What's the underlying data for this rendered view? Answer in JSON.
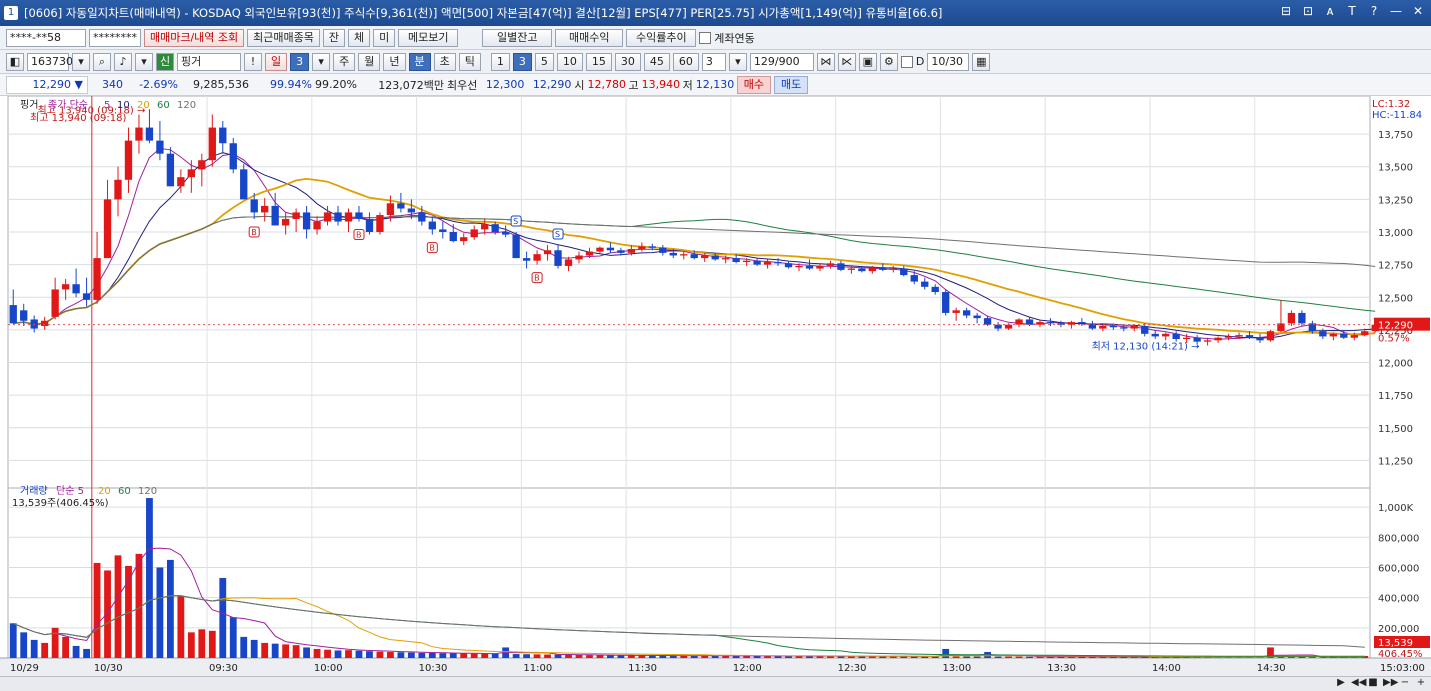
{
  "window": {
    "screen_code": "[0606]",
    "title": "자동일지차트(매매내역) - KOSDAQ 외국인보유[93(천)] 주식수[9,361(천)] 액면[500] 자본금[47(억)] 결산[12월] EPS[477] PER[25.75] 시가총액[1,149(억)] 유통비율[66.6]",
    "controls": [
      "⊟",
      "⊡",
      "ᴀ",
      "T",
      "?",
      "—",
      "✕"
    ]
  },
  "toolbar1": {
    "account": "****-**58",
    "password": "********",
    "btn_mark": "매매마크/내역 조회",
    "btn_recent": "최근매매종목",
    "btn_jan": "잔",
    "btn_che": "체",
    "btn_mi": "미",
    "btn_memo": "메모보기",
    "btn_daily_balance": "일별잔고",
    "btn_profit": "매매수익",
    "btn_return": "수익률추이",
    "chk_link": "계좌연동"
  },
  "toolbar2": {
    "code": "163730",
    "badge": "신",
    "stock_name": "핑거",
    "periods": [
      "일",
      "3",
      "주",
      "월",
      "년",
      "분",
      "초",
      "틱"
    ],
    "minutes": [
      "1",
      "3",
      "5",
      "10",
      "15",
      "30",
      "45",
      "60"
    ],
    "interval": "3",
    "count": "129",
    "count_max": "/900",
    "date_label": "D",
    "date": "10/30"
  },
  "quote": {
    "price": "12,290",
    "arrow": "▼",
    "change": "340",
    "change_pct": "-2.69%",
    "volume": "9,285,536",
    "vol_ratio": "99.94%",
    "vol_ratio2": "99.20%",
    "amount": "123,072백만",
    "best_label": "최우선",
    "best_ask": "12,300",
    "best_bid": "12,290",
    "open_label": "시",
    "open": "12,780",
    "high_label": "고",
    "high": "13,940",
    "low_label": "저",
    "low": "12,130",
    "buy": "매수",
    "sell": "매도"
  },
  "chart_data": [
    {
      "type": "candlestick",
      "panel": "price",
      "title": "핑거",
      "legend": [
        {
          "name": "종가 단순",
          "color": "#000000"
        },
        {
          "name": "5",
          "color": "#a020a0"
        },
        {
          "name": "10",
          "color": "#202080"
        },
        {
          "name": "20",
          "color": "#e0a000"
        },
        {
          "name": "60",
          "color": "#208040"
        },
        {
          "name": "120",
          "color": "#707070"
        }
      ],
      "ylim": [
        11100,
        13950
      ],
      "yticks": [
        13750,
        13500,
        13250,
        13000,
        12750,
        12500,
        12250,
        12000,
        11750,
        11500,
        11250
      ],
      "ytick_labels": [
        "13,750",
        "13,500",
        "13,250",
        "13,000",
        "12,750",
        "12,500",
        "12,250",
        "12,000",
        "11,750",
        "11,500",
        "11,250"
      ],
      "x_labels": [
        "10/29",
        "10/30",
        "09:30",
        "10:00",
        "10:30",
        "11:00",
        "11:30",
        "12:00",
        "12:30",
        "13:00",
        "13:30",
        "14:00",
        "14:30",
        "15:03:00"
      ],
      "x_label_bars": [
        0,
        8,
        19,
        29,
        39,
        49,
        59,
        69,
        79,
        89,
        99,
        109,
        119,
        129
      ],
      "bar_count": 130,
      "current_price": "12,290",
      "current_value": 12290,
      "current_pct": "0.57%",
      "lc": "LC:1.32",
      "hc": "HC:-11.84",
      "high_note": "최고 13,940 (09:18)",
      "low_note": "최저 12,130 (14:21)",
      "bars": [
        [
          12440,
          12560,
          12350,
          12300
        ],
        [
          12400,
          12450,
          12280,
          12320
        ],
        [
          12330,
          12360,
          12230,
          12260
        ],
        [
          12280,
          12350,
          12250,
          12320
        ],
        [
          12350,
          12650,
          12330,
          12560
        ],
        [
          12560,
          12640,
          12480,
          12600
        ],
        [
          12600,
          12720,
          12500,
          12530
        ],
        [
          12530,
          12650,
          12430,
          12480
        ],
        [
          12480,
          13000,
          12450,
          12800
        ],
        [
          12800,
          13400,
          12800,
          13250
        ],
        [
          13250,
          13500,
          13120,
          13400
        ],
        [
          13400,
          13800,
          13300,
          13700
        ],
        [
          13700,
          13900,
          13600,
          13800
        ],
        [
          13800,
          13940,
          13680,
          13700
        ],
        [
          13700,
          13850,
          13550,
          13600
        ],
        [
          13600,
          13650,
          13350,
          13350
        ],
        [
          13350,
          13480,
          13300,
          13420
        ],
        [
          13420,
          13550,
          13300,
          13480
        ],
        [
          13480,
          13600,
          13350,
          13550
        ],
        [
          13550,
          13900,
          13500,
          13800
        ],
        [
          13800,
          13850,
          13600,
          13680
        ],
        [
          13680,
          13720,
          13450,
          13480
        ],
        [
          13480,
          13520,
          13250,
          13250
        ],
        [
          13250,
          13300,
          13100,
          13150
        ],
        [
          13150,
          13260,
          13080,
          13200
        ],
        [
          13200,
          13300,
          13050,
          13050
        ],
        [
          13050,
          13150,
          12980,
          13100
        ],
        [
          13100,
          13180,
          13000,
          13150
        ],
        [
          13150,
          13200,
          12950,
          13020
        ],
        [
          13020,
          13120,
          12980,
          13080
        ],
        [
          13080,
          13200,
          13050,
          13150
        ],
        [
          13150,
          13200,
          13050,
          13080
        ],
        [
          13080,
          13180,
          13000,
          13150
        ],
        [
          13150,
          13200,
          13080,
          13100
        ],
        [
          13100,
          13150,
          12980,
          13000
        ],
        [
          13000,
          13150,
          12980,
          13130
        ],
        [
          13130,
          13280,
          13080,
          13220
        ],
        [
          13220,
          13300,
          13150,
          13180
        ],
        [
          13180,
          13250,
          13100,
          13150
        ],
        [
          13150,
          13200,
          13050,
          13080
        ],
        [
          13080,
          13120,
          12980,
          13020
        ],
        [
          13020,
          13080,
          12950,
          13000
        ],
        [
          13000,
          13060,
          12920,
          12930
        ],
        [
          12930,
          12990,
          12900,
          12960
        ],
        [
          12960,
          13050,
          12940,
          13020
        ],
        [
          13020,
          13100,
          12980,
          13060
        ],
        [
          13060,
          13080,
          12980,
          13000
        ],
        [
          13000,
          13050,
          12960,
          12980
        ],
        [
          12980,
          13000,
          12800,
          12800
        ],
        [
          12800,
          12850,
          12720,
          12780
        ],
        [
          12780,
          12860,
          12750,
          12830
        ],
        [
          12830,
          12900,
          12780,
          12860
        ],
        [
          12860,
          12900,
          12720,
          12740
        ],
        [
          12740,
          12810,
          12700,
          12790
        ],
        [
          12790,
          12850,
          12760,
          12820
        ],
        [
          12820,
          12880,
          12800,
          12850
        ],
        [
          12850,
          12890,
          12830,
          12880
        ],
        [
          12880,
          12920,
          12840,
          12860
        ],
        [
          12860,
          12880,
          12820,
          12840
        ],
        [
          12840,
          12900,
          12820,
          12870
        ],
        [
          12870,
          12920,
          12850,
          12890
        ],
        [
          12890,
          12910,
          12860,
          12880
        ],
        [
          12880,
          12900,
          12820,
          12840
        ],
        [
          12840,
          12870,
          12800,
          12820
        ],
        [
          12820,
          12850,
          12790,
          12830
        ],
        [
          12830,
          12860,
          12790,
          12800
        ],
        [
          12800,
          12840,
          12770,
          12820
        ],
        [
          12820,
          12840,
          12780,
          12790
        ],
        [
          12790,
          12820,
          12760,
          12800
        ],
        [
          12800,
          12830,
          12760,
          12770
        ],
        [
          12770,
          12800,
          12740,
          12780
        ],
        [
          12780,
          12800,
          12740,
          12750
        ],
        [
          12750,
          12790,
          12720,
          12770
        ],
        [
          12770,
          12800,
          12740,
          12760
        ],
        [
          12760,
          12780,
          12720,
          12730
        ],
        [
          12730,
          12760,
          12700,
          12740
        ],
        [
          12740,
          12790,
          12710,
          12720
        ],
        [
          12720,
          12760,
          12700,
          12740
        ],
        [
          12740,
          12780,
          12720,
          12760
        ],
        [
          12760,
          12780,
          12700,
          12710
        ],
        [
          12710,
          12740,
          12680,
          12720
        ],
        [
          12720,
          12740,
          12690,
          12700
        ],
        [
          12700,
          12740,
          12680,
          12730
        ],
        [
          12730,
          12760,
          12700,
          12710
        ],
        [
          12710,
          12740,
          12690,
          12720
        ],
        [
          12720,
          12740,
          12660,
          12670
        ],
        [
          12670,
          12700,
          12600,
          12620
        ],
        [
          12620,
          12650,
          12560,
          12580
        ],
        [
          12580,
          12600,
          12520,
          12540
        ],
        [
          12540,
          12560,
          12360,
          12380
        ],
        [
          12380,
          12420,
          12320,
          12400
        ],
        [
          12400,
          12420,
          12340,
          12360
        ],
        [
          12360,
          12380,
          12300,
          12340
        ],
        [
          12340,
          12360,
          12280,
          12290
        ],
        [
          12290,
          12310,
          12240,
          12260
        ],
        [
          12260,
          12300,
          12250,
          12290
        ],
        [
          12290,
          12340,
          12270,
          12330
        ],
        [
          12330,
          12350,
          12280,
          12290
        ],
        [
          12290,
          12330,
          12270,
          12310
        ],
        [
          12310,
          12340,
          12280,
          12300
        ],
        [
          12300,
          12320,
          12270,
          12290
        ],
        [
          12290,
          12320,
          12260,
          12310
        ],
        [
          12310,
          12340,
          12280,
          12300
        ],
        [
          12300,
          12320,
          12250,
          12260
        ],
        [
          12260,
          12290,
          12240,
          12280
        ],
        [
          12280,
          12300,
          12250,
          12270
        ],
        [
          12270,
          12290,
          12240,
          12260
        ],
        [
          12260,
          12290,
          12240,
          12280
        ],
        [
          12280,
          12300,
          12200,
          12220
        ],
        [
          12220,
          12250,
          12180,
          12200
        ],
        [
          12200,
          12230,
          12170,
          12220
        ],
        [
          12220,
          12240,
          12160,
          12180
        ],
        [
          12180,
          12220,
          12150,
          12190
        ],
        [
          12190,
          12210,
          12140,
          12160
        ],
        [
          12160,
          12190,
          12130,
          12170
        ],
        [
          12170,
          12200,
          12150,
          12190
        ],
        [
          12190,
          12220,
          12170,
          12200
        ],
        [
          12200,
          12230,
          12180,
          12210
        ],
        [
          12210,
          12240,
          12180,
          12190
        ],
        [
          12190,
          12220,
          12150,
          12170
        ],
        [
          12170,
          12250,
          12160,
          12240
        ],
        [
          12240,
          12480,
          12230,
          12300
        ],
        [
          12300,
          12400,
          12280,
          12380
        ],
        [
          12380,
          12400,
          12280,
          12300
        ],
        [
          12300,
          12320,
          12220,
          12240
        ],
        [
          12240,
          12260,
          12180,
          12200
        ],
        [
          12200,
          12230,
          12170,
          12220
        ],
        [
          12220,
          12250,
          12180,
          12190
        ],
        [
          12190,
          12230,
          12170,
          12210
        ],
        [
          12210,
          12260,
          12200,
          12240
        ],
        [
          12240,
          12300,
          12230,
          12290
        ]
      ],
      "trade_marks": [
        {
          "type": "B",
          "bar": 23
        },
        {
          "type": "B",
          "bar": 33
        },
        {
          "type": "B",
          "bar": 40
        },
        {
          "type": "B",
          "bar": 50
        },
        {
          "type": "S",
          "bar": 48
        },
        {
          "type": "S",
          "bar": 52
        }
      ]
    },
    {
      "type": "bar",
      "panel": "volume",
      "title": "거래량",
      "legend": [
        {
          "name": "단순 5",
          "color": "#a020a0"
        },
        {
          "name": "20",
          "color": "#e0a000"
        },
        {
          "name": "60",
          "color": "#208040"
        },
        {
          "name": "120",
          "color": "#707070"
        }
      ],
      "current_label": "13,539주(406.45%)",
      "current_value": "13,539",
      "current_pct": "406.45%",
      "ylim": [
        0,
        1100000
      ],
      "yticks": [
        1000000,
        800000,
        600000,
        400000,
        200000
      ],
      "ytick_labels": [
        "1,000K",
        "800,000",
        "600,000",
        "400,000",
        "200,000"
      ],
      "values": [
        230000,
        170000,
        120000,
        100000,
        200000,
        140000,
        80000,
        60000,
        630000,
        580000,
        680000,
        610000,
        690000,
        1060000,
        600000,
        650000,
        410000,
        170000,
        190000,
        180000,
        530000,
        270000,
        140000,
        120000,
        100000,
        95000,
        90000,
        85000,
        70000,
        60000,
        55000,
        50000,
        52000,
        48000,
        45000,
        42000,
        40000,
        38000,
        36000,
        34000,
        33000,
        32000,
        31000,
        30000,
        29000,
        28000,
        27000,
        70000,
        26000,
        25000,
        24000,
        23000,
        22000,
        21000,
        20000,
        19000,
        18500,
        18000,
        17500,
        17000,
        16500,
        16000,
        15500,
        15000,
        14800,
        14600,
        14400,
        14200,
        14000,
        13800,
        13600,
        13400,
        13200,
        13000,
        12800,
        12600,
        12400,
        12200,
        12000,
        11800,
        11600,
        11400,
        11200,
        11000,
        10800,
        10600,
        10400,
        10200,
        10000,
        60000,
        9800,
        9600,
        9400,
        40000,
        9200,
        9000,
        8800,
        8600,
        8400,
        8200,
        8000,
        7800,
        7600,
        7400,
        7200,
        7000,
        6800,
        6600,
        6400,
        6200,
        6000,
        5800,
        5600,
        5400,
        5200,
        5000,
        4800,
        4600,
        4400,
        4200,
        70000,
        9000,
        8000,
        7000,
        6000,
        5000,
        5000,
        5000,
        5000,
        13539
      ]
    }
  ]
}
